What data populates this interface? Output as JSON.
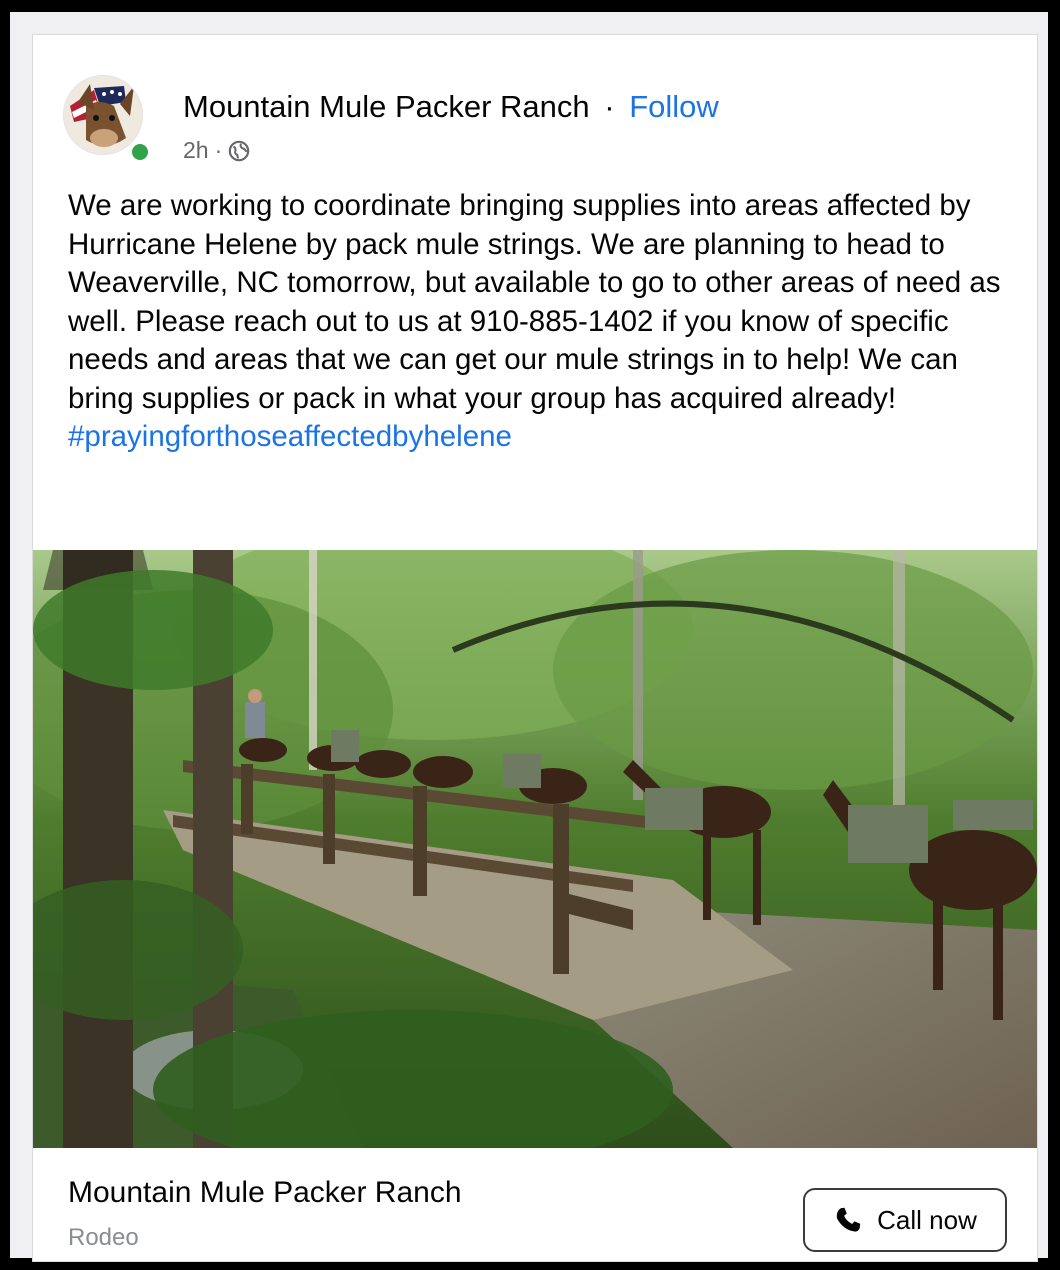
{
  "post": {
    "author": "Mountain Mule Packer Ranch",
    "separator": "·",
    "follow_label": "Follow",
    "time": "2h",
    "time_separator": "·",
    "privacy_icon": "globe-icon",
    "body_text": "We are working to coordinate bringing supplies into areas affected by Hurricane Helene by pack mule strings. We are planning to head to Weaverville, NC tomorrow, but available to go to other areas of need as well. Please reach out to us at 910-885-1402 if you know of specific needs and areas that we can get our mule strings in to help! We can bring supplies or pack in what your group has acquired already! ",
    "hashtag": "#prayingforthoseaffectedbyhelene"
  },
  "footer": {
    "page_name": "Mountain Mule Packer Ranch",
    "category": "Rodeo",
    "call_label": "Call now",
    "call_icon": "phone-icon"
  },
  "colors": {
    "link_blue": "#1b74e4",
    "online_green": "#31a24c",
    "secondary_text": "#65676b"
  }
}
